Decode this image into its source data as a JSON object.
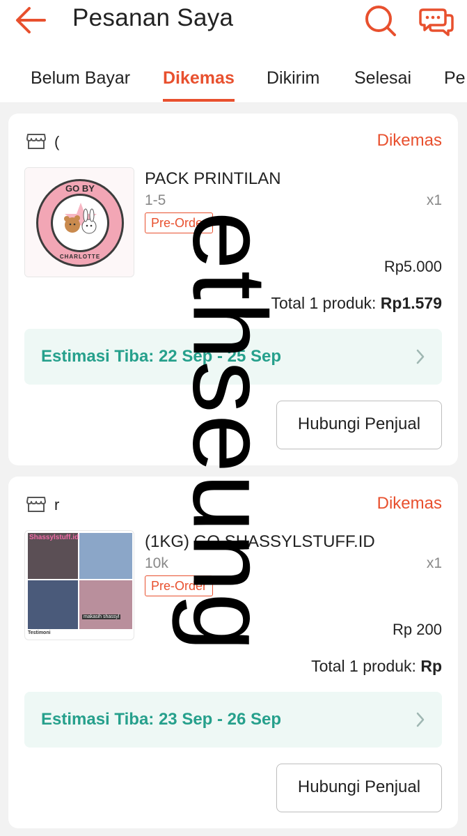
{
  "header": {
    "title": "Pesanan Saya",
    "back_icon": "arrow-left-icon",
    "search_icon": "search-icon",
    "chat_icon": "chat-bubbles-icon"
  },
  "tabs": [
    {
      "label": "Belum Bayar",
      "active": false
    },
    {
      "label": "Dikemas",
      "active": true
    },
    {
      "label": "Dikirim",
      "active": false
    },
    {
      "label": "Selesai",
      "active": false
    },
    {
      "label": "Pe",
      "active": false
    }
  ],
  "orders": [
    {
      "store_name": "(",
      "status": "Dikemas",
      "product_name": "PACK PRINTILAN",
      "variant": "1-5",
      "badge": "Pre-Order",
      "quantity": "x1",
      "unit_price": "Rp5.000",
      "total_label": "Total 1 produk:",
      "total_value": "Rp1.579",
      "estimate": "Estimasi Tiba: 22 Sep - 25 Sep",
      "contact_button": "Hubungi Penjual",
      "thumb_logo_top": "GO BY",
      "thumb_logo_bottom": "CHARLOTTE"
    },
    {
      "store_name": "r",
      "status": "Dikemas",
      "product_name": "(1KG) GO SHASSYLSTUFF.ID",
      "variant": "10k",
      "badge": "Pre-Order",
      "quantity": "x1",
      "unit_price": "Rp 200",
      "total_label": "Total 1 produk:",
      "total_value": "Rp",
      "estimate": "Estimasi Tiba: 23 Sep - 26 Sep",
      "contact_button": "Hubungi Penjual",
      "thumb_title": "Shassylstuff.id",
      "thumb_caption": "makasih shassyl",
      "thumb_footer": "Testimoni"
    }
  ],
  "watermark": "ethseung",
  "colors": {
    "accent": "#e8502e",
    "estimate_text": "#26a08c",
    "estimate_bg": "#eef8f5"
  }
}
